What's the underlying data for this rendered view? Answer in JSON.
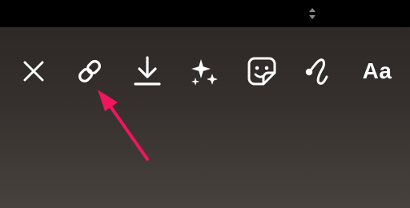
{
  "toolbar": {
    "items": [
      {
        "name": "close",
        "icon": "close-icon"
      },
      {
        "name": "link",
        "icon": "link-icon"
      },
      {
        "name": "download",
        "icon": "download-icon"
      },
      {
        "name": "effects",
        "icon": "sparkles-icon"
      },
      {
        "name": "sticker",
        "icon": "sticker-icon"
      },
      {
        "name": "draw",
        "icon": "squiggle-pen-icon"
      },
      {
        "name": "text",
        "icon": "text-icon"
      }
    ],
    "text_label": "Aa"
  },
  "colors": {
    "status_bar": "#000000",
    "background_top": "#2b2624",
    "background_bottom": "#48423e",
    "icon": "#ffffff",
    "annotation_arrow": "#f0155e"
  }
}
